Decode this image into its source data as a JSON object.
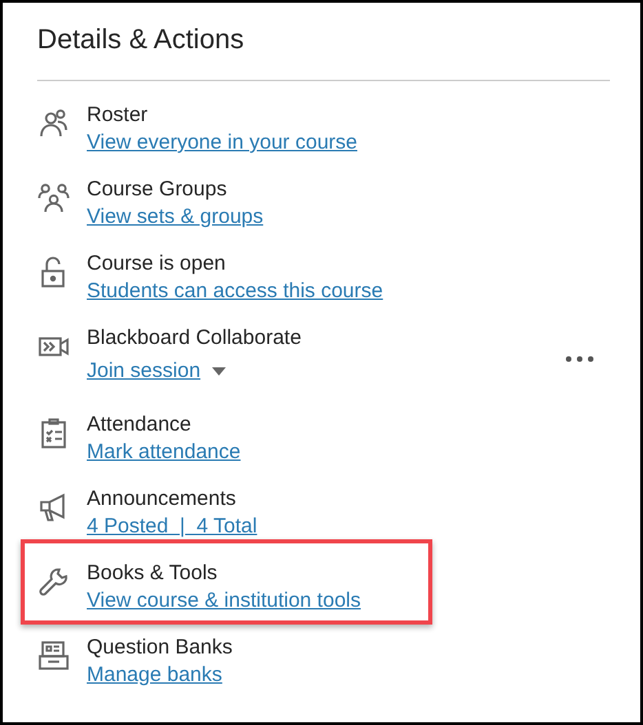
{
  "panel": {
    "title": "Details & Actions"
  },
  "items": [
    {
      "kind": "roster",
      "title": "Roster",
      "link": "View everyone in your course",
      "highlighted": false,
      "dropdown": false,
      "more_menu": false
    },
    {
      "kind": "groups",
      "title": "Course Groups",
      "link": "View sets & groups",
      "highlighted": false,
      "dropdown": false,
      "more_menu": false
    },
    {
      "kind": "lock",
      "title": "Course is open",
      "link": "Students can access this course",
      "highlighted": false,
      "dropdown": false,
      "more_menu": false
    },
    {
      "kind": "video",
      "title": "Blackboard Collaborate",
      "link": "Join session",
      "highlighted": false,
      "dropdown": true,
      "more_menu": true
    },
    {
      "kind": "attendance",
      "title": "Attendance",
      "link": "Mark attendance",
      "highlighted": false,
      "dropdown": false,
      "more_menu": false
    },
    {
      "kind": "megaphone",
      "title": "Announcements",
      "link": "4 Posted  |  4 Total",
      "highlighted": false,
      "dropdown": false,
      "more_menu": false
    },
    {
      "kind": "wrench",
      "title": "Books & Tools",
      "link": "View course & institution tools",
      "highlighted": true,
      "dropdown": false,
      "more_menu": false
    },
    {
      "kind": "bank",
      "title": "Question Banks",
      "link": "Manage banks",
      "highlighted": false,
      "dropdown": false,
      "more_menu": false
    }
  ]
}
